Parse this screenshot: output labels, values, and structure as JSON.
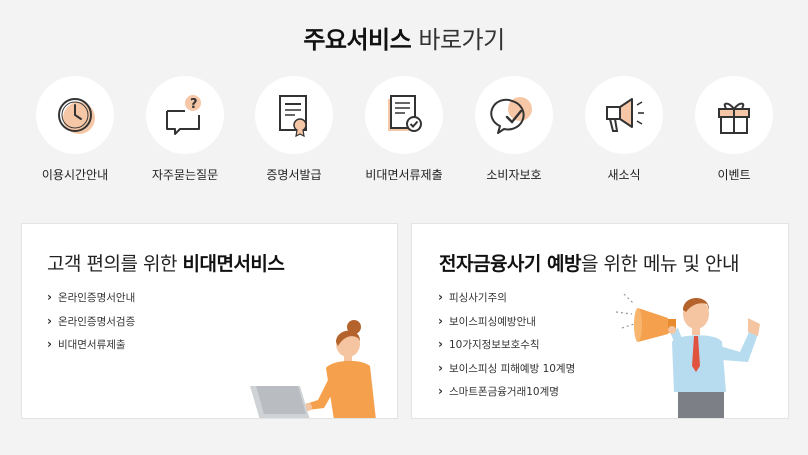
{
  "header": {
    "title_bold": "주요서비스",
    "title_light": "바로가기"
  },
  "services": [
    {
      "label": "이용시간안내",
      "icon": "clock-icon"
    },
    {
      "label": "자주묻는질문",
      "icon": "question-bubble-icon"
    },
    {
      "label": "증명서발급",
      "icon": "certificate-icon"
    },
    {
      "label": "비대면서류제출",
      "icon": "document-check-icon"
    },
    {
      "label": "소비자보호",
      "icon": "protection-chat-icon"
    },
    {
      "label": "새소식",
      "icon": "megaphone-icon"
    },
    {
      "label": "이벤트",
      "icon": "gift-icon"
    }
  ],
  "left_card": {
    "title_prefix": "고객 편의를 위한",
    "title_bold": "비대면서비스",
    "links": [
      "온라인증명서안내",
      "온라인증명서검증",
      "비대면서류제출"
    ]
  },
  "right_card": {
    "title_bold": "전자금융사기 예방",
    "title_suffix": "을 위한 메뉴 및 안내",
    "links": [
      "피싱사기주의",
      "보이스피싱예방안내",
      "10가지정보보호수칙",
      "보이스피싱 피해예방 10계명",
      "스마트폰금융거래10계명"
    ]
  },
  "colors": {
    "accent_peach": "#f6c7a6",
    "orange": "#f5a04d",
    "background": "#f3f3f3"
  }
}
